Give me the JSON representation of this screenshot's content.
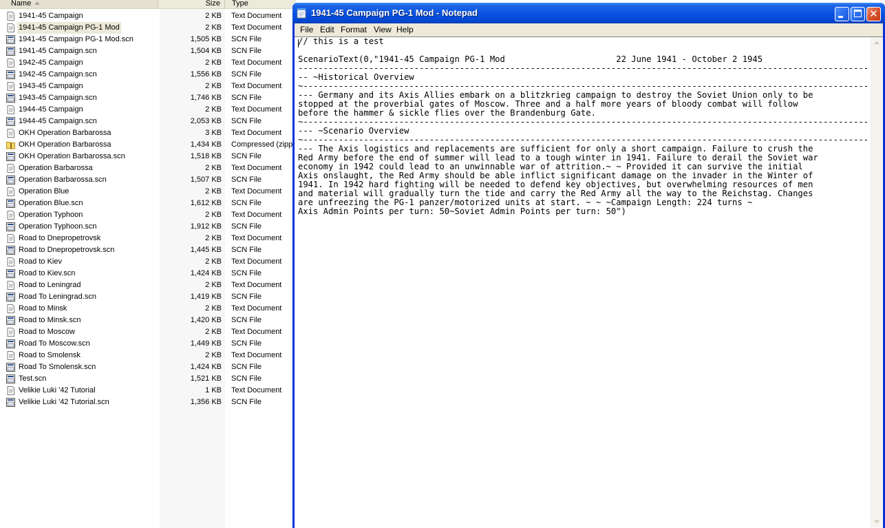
{
  "explorer": {
    "columns": {
      "name": "Name",
      "size": "Size",
      "type": "Type"
    },
    "files": [
      {
        "name": "1941-45 Campaign",
        "size": "2 KB",
        "type": "Text Document",
        "icon": "text-document-icon"
      },
      {
        "name": "1941-45 Campaign PG-1 Mod",
        "size": "2 KB",
        "type": "Text Document",
        "icon": "text-document-icon",
        "selected": true
      },
      {
        "name": "1941-45 Campaign PG-1 Mod.scn",
        "size": "1,505 KB",
        "type": "SCN File",
        "icon": "scn-file-icon"
      },
      {
        "name": "1941-45 Campaign.scn",
        "size": "1,504 KB",
        "type": "SCN File",
        "icon": "scn-file-icon"
      },
      {
        "name": "1942-45 Campaign",
        "size": "2 KB",
        "type": "Text Document",
        "icon": "text-document-icon"
      },
      {
        "name": "1942-45 Campaign.scn",
        "size": "1,556 KB",
        "type": "SCN File",
        "icon": "scn-file-icon"
      },
      {
        "name": "1943-45 Campaign",
        "size": "2 KB",
        "type": "Text Document",
        "icon": "text-document-icon"
      },
      {
        "name": "1943-45 Campaign.scn",
        "size": "1,746 KB",
        "type": "SCN File",
        "icon": "scn-file-icon"
      },
      {
        "name": "1944-45 Campaign",
        "size": "2 KB",
        "type": "Text Document",
        "icon": "text-document-icon"
      },
      {
        "name": "1944-45 Campaign.scn",
        "size": "2,053 KB",
        "type": "SCN File",
        "icon": "scn-file-icon"
      },
      {
        "name": "OKH Operation Barbarossa",
        "size": "3 KB",
        "type": "Text Document",
        "icon": "text-document-icon"
      },
      {
        "name": "OKH Operation Barbarossa",
        "size": "1,434 KB",
        "type": "Compressed (zipped",
        "icon": "zip-folder-icon"
      },
      {
        "name": "OKH Operation Barbarossa.scn",
        "size": "1,518 KB",
        "type": "SCN File",
        "icon": "scn-file-icon"
      },
      {
        "name": "Operation Barbarossa",
        "size": "2 KB",
        "type": "Text Document",
        "icon": "text-document-icon"
      },
      {
        "name": "Operation Barbarossa.scn",
        "size": "1,507 KB",
        "type": "SCN File",
        "icon": "scn-file-icon"
      },
      {
        "name": "Operation Blue",
        "size": "2 KB",
        "type": "Text Document",
        "icon": "text-document-icon"
      },
      {
        "name": "Operation Blue.scn",
        "size": "1,612 KB",
        "type": "SCN File",
        "icon": "scn-file-icon"
      },
      {
        "name": "Operation Typhoon",
        "size": "2 KB",
        "type": "Text Document",
        "icon": "text-document-icon"
      },
      {
        "name": "Operation Typhoon.scn",
        "size": "1,912 KB",
        "type": "SCN File",
        "icon": "scn-file-icon"
      },
      {
        "name": "Road to Dnepropetrovsk",
        "size": "2 KB",
        "type": "Text Document",
        "icon": "text-document-icon"
      },
      {
        "name": "Road to Dnepropetrovsk.scn",
        "size": "1,445 KB",
        "type": "SCN File",
        "icon": "scn-file-icon"
      },
      {
        "name": "Road to Kiev",
        "size": "2 KB",
        "type": "Text Document",
        "icon": "text-document-icon"
      },
      {
        "name": "Road to Kiev.scn",
        "size": "1,424 KB",
        "type": "SCN File",
        "icon": "scn-file-icon"
      },
      {
        "name": "Road to Leningrad",
        "size": "2 KB",
        "type": "Text Document",
        "icon": "text-document-icon"
      },
      {
        "name": "Road To Leningrad.scn",
        "size": "1,419 KB",
        "type": "SCN File",
        "icon": "scn-file-icon"
      },
      {
        "name": "Road to Minsk",
        "size": "2 KB",
        "type": "Text Document",
        "icon": "text-document-icon"
      },
      {
        "name": "Road to Minsk.scn",
        "size": "1,420 KB",
        "type": "SCN File",
        "icon": "scn-file-icon"
      },
      {
        "name": "Road to Moscow",
        "size": "2 KB",
        "type": "Text Document",
        "icon": "text-document-icon"
      },
      {
        "name": "Road To Moscow.scn",
        "size": "1,449 KB",
        "type": "SCN File",
        "icon": "scn-file-icon"
      },
      {
        "name": "Road to Smolensk",
        "size": "2 KB",
        "type": "Text Document",
        "icon": "text-document-icon"
      },
      {
        "name": "Road To Smolensk.scn",
        "size": "1,424 KB",
        "type": "SCN File",
        "icon": "scn-file-icon"
      },
      {
        "name": "Test.scn",
        "size": "1,521 KB",
        "type": "SCN File",
        "icon": "scn-file-icon"
      },
      {
        "name": "Velikie Luki '42 Tutorial",
        "size": "1 KB",
        "type": "Text Document",
        "icon": "text-document-icon"
      },
      {
        "name": "Velikie Luki '42 Tutorial.scn",
        "size": "1,356 KB",
        "type": "SCN File",
        "icon": "scn-file-icon"
      }
    ]
  },
  "notepad": {
    "title": "1941-45 Campaign PG-1 Mod - Notepad",
    "app_icon": "notepad-icon",
    "menu": [
      "File",
      "Edit",
      "Format",
      "View",
      "Help"
    ],
    "content": "// this is a test\n\nScenarioText(0,\"1941-45 Campaign PG-1 Mod                      22 June 1941 - October 2 1945\n-------------------------------------------------------------------------------------------------------------------------\n-- ~Historical Overview\n~----------------------------------------------------------------------------------------------------------------------------\n--- Germany and its Axis Allies embark on a blitzkrieg campaign to destroy the Soviet Union only to be\nstopped at the proverbial gates of Moscow. Three and a half more years of bloody combat will follow\nbefore the hammer & sickle flies over the Brandenburg Gate.\n~----------------------------------------------------------------------------------------------------------------------------\n--- ~Scenario Overview\n~----------------------------------------------------------------------------------------------------------------------------\n--- The Axis logistics and replacements are sufficient for only a short campaign. Failure to crush the\nRed Army before the end of summer will lead to a tough winter in 1941. Failure to derail the Soviet war\neconomy in 1942 could lead to an unwinnable war of attrition.~ ~ Provided it can survive the initial\nAxis onslaught, the Red Army should be able inflict significant damage on the invader in the Winter of\n1941. In 1942 hard fighting will be needed to defend key objectives, but overwhelming resources of men\nand material will gradually turn the tide and carry the Red Army all the way to the Reichstag. Changes\nare unfreezing the PG-1 panzer/motorized units at start. ~ ~ ~Campaign Length: 224 turns ~\nAxis Admin Points per turn: 50~Soviet Admin Points per turn: 50\")"
  },
  "colors": {
    "titlebar": "#0a54e2",
    "window_border": "#0831d9",
    "menubar": "#ece9d8",
    "close_button": "#d9542e",
    "selection": "#ece9d8"
  }
}
